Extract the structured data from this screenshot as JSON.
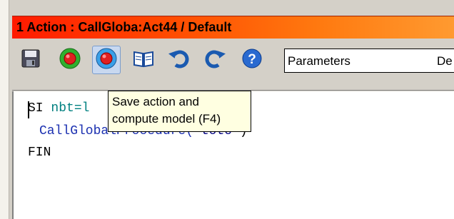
{
  "window": {
    "title": "1  Action : CallGloba:Act44 / Default"
  },
  "toolbar": {
    "buttons": [
      {
        "name": "save-button",
        "icon": "floppy-disk-icon"
      },
      {
        "name": "run-button",
        "icon": "green-record-icon"
      },
      {
        "name": "save-compute-button",
        "icon": "red-record-icon"
      },
      {
        "name": "book-button",
        "icon": "open-book-icon"
      },
      {
        "name": "undo-button",
        "icon": "undo-arrow-icon"
      },
      {
        "name": "redo-button",
        "icon": "redo-arrow-icon"
      },
      {
        "name": "help-button",
        "icon": "help-question-icon"
      }
    ],
    "params_label": "Parameters",
    "params_extra": "De"
  },
  "tooltip": {
    "line1": "Save action and",
    "line2": "compute model (F4)"
  },
  "editor": {
    "line1_kw": "SI",
    "line1_var": "nbt=l",
    "line2_fn": "CallGlobalProcedure(",
    "line2_str": "\"toto\"",
    "line2_end": ")",
    "line3": "FIN"
  },
  "colors": {
    "title_start": "#ff1a00",
    "title_end": "#ff9a30",
    "variable": "#008080",
    "function": "#1a2fb0",
    "tooltip_bg": "#ffffe1"
  }
}
